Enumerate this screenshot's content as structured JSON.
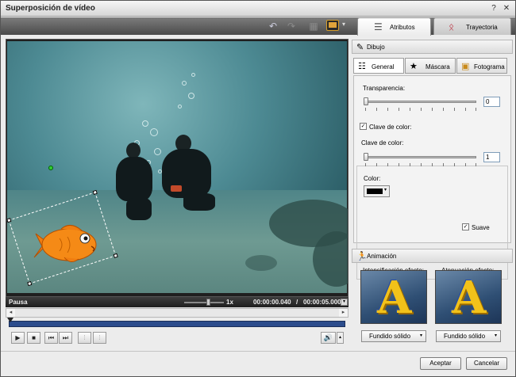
{
  "window": {
    "title": "Superposición de vídeo",
    "close_glyph": "✕",
    "help_glyph": "?"
  },
  "toolbar": {
    "undo_icon": "↶",
    "redo_icon": "↷",
    "grid_icon": "▦",
    "monitor_caret": "▾"
  },
  "tabs": [
    {
      "label": "Atributos",
      "icon": "sliders-icon",
      "active": true
    },
    {
      "label": "Trayectoria",
      "icon": "trajectory-icon",
      "active": false
    }
  ],
  "player": {
    "state": "Pausa",
    "speed": "1x",
    "current_time": "00:00:00.040",
    "separator": "/",
    "total_time": "00:00:05.000",
    "speed_level": 0.55,
    "timeline_position": 0.0
  },
  "playback_buttons": [
    {
      "name": "play-button",
      "glyph": "▶",
      "enabled": true
    },
    {
      "name": "stop-button",
      "glyph": "■",
      "enabled": true
    },
    {
      "name": "prev-frame-button",
      "glyph": "⏮",
      "enabled": true
    },
    {
      "name": "next-frame-button",
      "glyph": "⏭",
      "enabled": true
    },
    {
      "name": "mark-in-button",
      "glyph": "⁞",
      "enabled": false
    },
    {
      "name": "mark-out-button",
      "glyph": "⁞",
      "enabled": false
    }
  ],
  "volume": {
    "glyph": "🔊",
    "caret": "▴"
  },
  "dibujo": {
    "header": "Dibujo",
    "subtabs": [
      {
        "label": "General",
        "icon": "general-icon",
        "active": true
      },
      {
        "label": "Máscara",
        "icon": "star-icon",
        "active": false
      },
      {
        "label": "Fotograma",
        "icon": "frame-icon",
        "active": false
      }
    ],
    "transparency_label": "Transparencia:",
    "transparency_value": "0",
    "transparency_level": 0.0,
    "chroma_key_checkbox_label": "Clave de color:",
    "chroma_key_enabled": true,
    "chroma_key_label": "Clave de color:",
    "chroma_key_value": "1",
    "chroma_key_level": 0.0,
    "color_label": "Color:",
    "color_value": "#000000",
    "smooth_label": "Suave",
    "smooth_enabled": true
  },
  "animacion": {
    "header": "Animación",
    "fade_in_label": "Intensificación efecto:",
    "fade_out_label": "Atenuación efecto:",
    "tile_letter": "A",
    "fade_in_value": "Fundido sólido",
    "fade_out_value": "Fundido sólido"
  },
  "dialog_buttons": {
    "accept": "Aceptar",
    "cancel": "Cancelar"
  }
}
